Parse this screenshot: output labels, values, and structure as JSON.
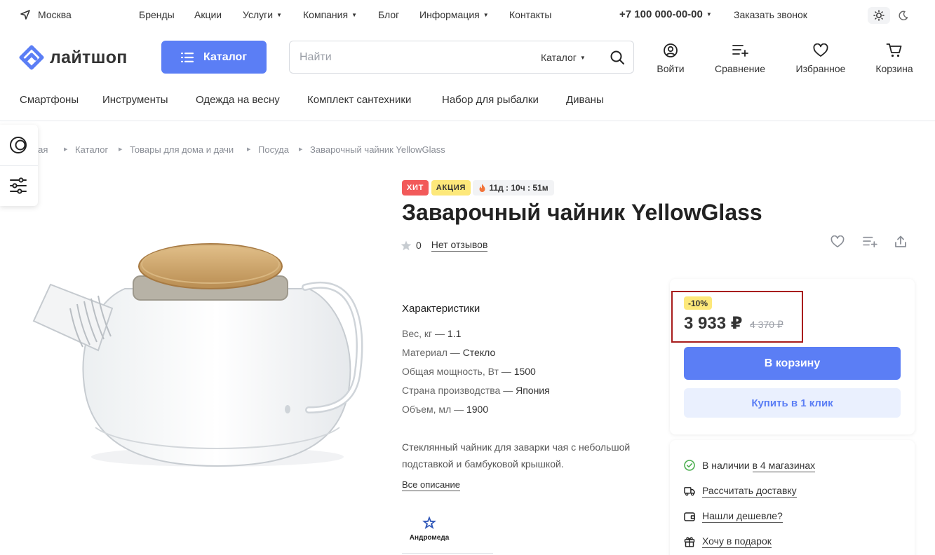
{
  "topbar": {
    "city": "Москва",
    "nav": [
      {
        "label": "Бренды",
        "dropdown": false
      },
      {
        "label": "Акции",
        "dropdown": false
      },
      {
        "label": "Услуги",
        "dropdown": true
      },
      {
        "label": "Компания",
        "dropdown": true
      },
      {
        "label": "Блог",
        "dropdown": false
      },
      {
        "label": "Информация",
        "dropdown": true
      },
      {
        "label": "Контакты",
        "dropdown": false
      }
    ],
    "phone": "+7 100 000-00-00",
    "callback": "Заказать звонок"
  },
  "header": {
    "logo": "лайтшоп",
    "catalog_label": "Каталог",
    "search_placeholder": "Найти",
    "search_scope": "Каталог",
    "actions": {
      "login": "Войти",
      "compare": "Сравнение",
      "favorites": "Избранное",
      "cart": "Корзина"
    }
  },
  "quick_categories": [
    "Смартфоны",
    "Инструменты",
    "Одежда на весну",
    "Комплект сантехники",
    "Набор для рыбалки",
    "Диваны"
  ],
  "breadcrumbs": [
    "вная",
    "Каталог",
    "Товары для дома и дачи",
    "Посуда",
    "Заварочный чайник YellowGlass"
  ],
  "product": {
    "badges": {
      "hit": "ХИТ",
      "sale": "АКЦИЯ",
      "timer": "11д : 10ч : 51м"
    },
    "title": "Заварочный чайник YellowGlass",
    "rating": "0",
    "reviews_link": "Нет отзывов",
    "characteristics_title": "Характеристики",
    "characteristics": [
      {
        "name": "Вес, кг",
        "value": "1.1"
      },
      {
        "name": "Материал",
        "value": "Стекло"
      },
      {
        "name": "Общая мощность, Вт",
        "value": "1500"
      },
      {
        "name": "Страна производства",
        "value": "Япония"
      },
      {
        "name": "Объем, мл",
        "value": "1900"
      }
    ],
    "description": "Стеклянный чайник для заварки чая с небольшой подставкой и бамбуковой крышкой.",
    "more_link": "Все описание",
    "brand": "Андромеда"
  },
  "price_card": {
    "discount": "-10%",
    "price": "3 933 ₽",
    "old_price": "4 370 ₽",
    "cart_button": "В корзину",
    "one_click_button": "Купить в 1 клик"
  },
  "info": {
    "stock_prefix": "В наличии",
    "stock_link": "в 4 магазинах",
    "delivery": "Рассчитать доставку",
    "cheaper": "Нашли дешевле?",
    "gift": "Хочу в подарок"
  },
  "colors": {
    "accent": "#5b7ef5",
    "accent_light": "#eaf0fe",
    "hit_badge": "#f25a5a",
    "sale_badge": "#fde87a",
    "highlight_border": "#a81d1d",
    "in_stock": "#4caf50"
  }
}
